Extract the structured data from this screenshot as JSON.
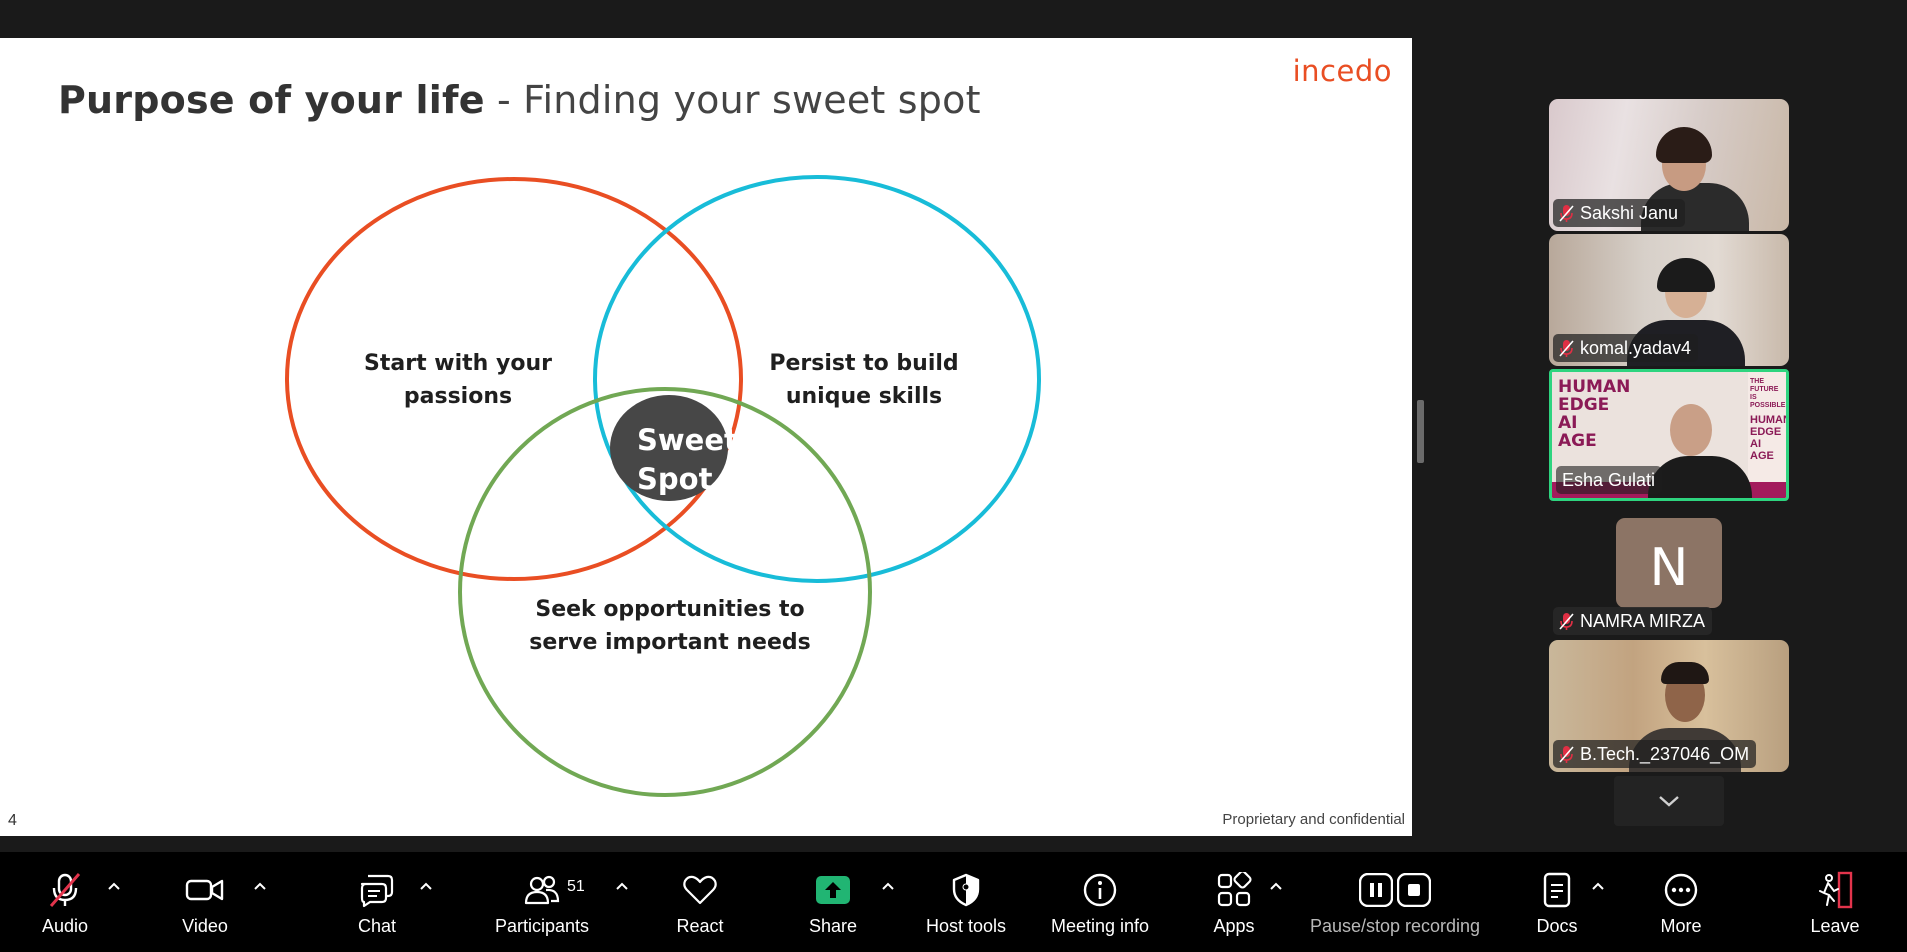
{
  "slide": {
    "title_bold": "Purpose of your life",
    "title_rest": " - Finding your sweet spot",
    "logo": "incedo",
    "circles": {
      "passions": "Start with your\npassions",
      "skills": "Persist to build\nunique skills",
      "needs": "Seek opportunities to\nserve important needs"
    },
    "center_label": "Sweet\nSpot",
    "page_number": "4",
    "footer": "Proprietary and confidential",
    "colors": {
      "passions": "#e94e23",
      "skills": "#18bcd8",
      "needs": "#71a854",
      "center": "#474747"
    }
  },
  "participants": [
    {
      "name": "Sakshi Janu",
      "muted": true
    },
    {
      "name": "komal.yadav4",
      "muted": true
    },
    {
      "name": "Esha Gulati",
      "muted": false,
      "active_speaker": true,
      "book_left": "HUMAN\nEDGE\nAI\nAGE",
      "book_right_header": "THE FUTURE IS\nPOSSIBLE",
      "book_right": "HUMAN\nEDGE\nAI\nAGE"
    },
    {
      "name": "NAMRA MIRZA",
      "muted": true,
      "avatar_letter": "N"
    },
    {
      "name": "B.Tech._237046_OM",
      "muted": true
    }
  ],
  "toolbar": {
    "audio": "Audio",
    "video": "Video",
    "chat": "Chat",
    "participants": "Participants",
    "participant_count": "51",
    "react": "React",
    "share": "Share",
    "host_tools": "Host tools",
    "meeting_info": "Meeting info",
    "apps": "Apps",
    "recording": "Pause/stop recording",
    "docs": "Docs",
    "more": "More",
    "leave": "Leave",
    "accent_share": "#21b573",
    "accent_leave": "#e3344c"
  }
}
